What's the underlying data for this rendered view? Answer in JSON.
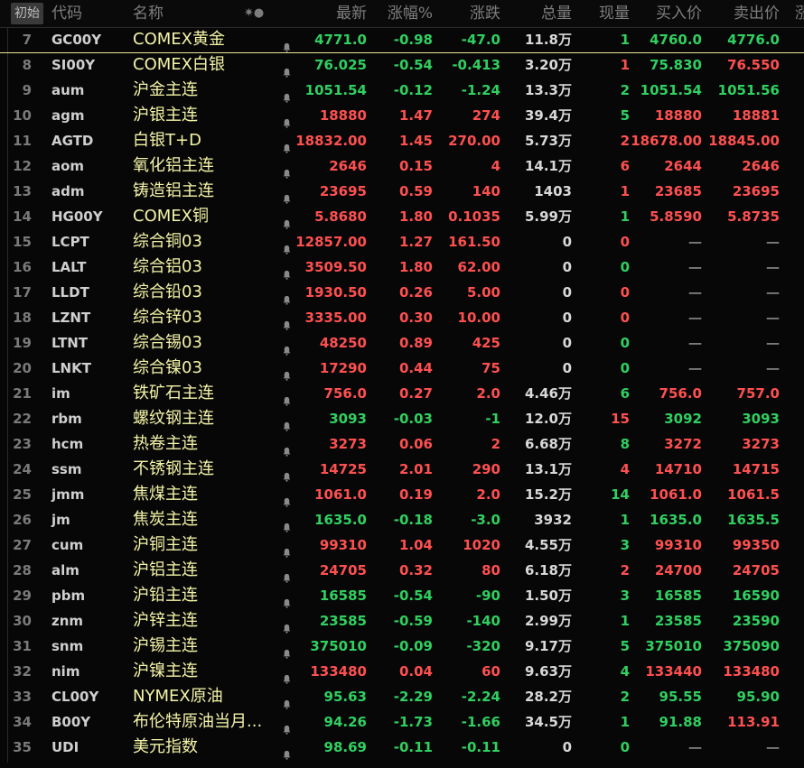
{
  "header": {
    "init_label": "初始",
    "columns": [
      "代码",
      "名称",
      "最新",
      "涨幅%",
      "涨跌",
      "总量",
      "现量",
      "买入价",
      "卖出价",
      "涨"
    ],
    "toggle_icons": "✷●"
  },
  "colors": {
    "up": "#ff5050",
    "down": "#30d060",
    "name": "#f4f4a8"
  },
  "rows": [
    {
      "num": "7",
      "code": "GC00Y",
      "name": "COMEX黄金",
      "last": "4771.0",
      "pct": "-0.98",
      "chg": "-47.0",
      "total": "11.8万",
      "cur": "1",
      "cur_dir": "dn",
      "bid": "4760.0",
      "bid_dir": "dn",
      "ask": "4776.0",
      "ask_dir": "dn"
    },
    {
      "num": "8",
      "code": "SI00Y",
      "name": "COMEX白银",
      "last": "76.025",
      "pct": "-0.54",
      "chg": "-0.413",
      "total": "3.20万",
      "cur": "1",
      "cur_dir": "up",
      "bid": "75.830",
      "bid_dir": "dn",
      "ask": "76.550",
      "ask_dir": "up"
    },
    {
      "num": "9",
      "code": "aum",
      "name": "沪金主连",
      "last": "1051.54",
      "pct": "-0.12",
      "chg": "-1.24",
      "total": "13.3万",
      "cur": "2",
      "cur_dir": "dn",
      "bid": "1051.54",
      "bid_dir": "dn",
      "ask": "1051.56",
      "ask_dir": "dn"
    },
    {
      "num": "10",
      "code": "agm",
      "name": "沪银主连",
      "last": "18880",
      "pct": "1.47",
      "chg": "274",
      "total": "39.4万",
      "cur": "5",
      "cur_dir": "dn",
      "bid": "18880",
      "bid_dir": "up",
      "ask": "18881",
      "ask_dir": "up"
    },
    {
      "num": "11",
      "code": "AGTD",
      "name": "白银T+D",
      "last": "18832.00",
      "pct": "1.45",
      "chg": "270.00",
      "total": "5.73万",
      "cur": "2",
      "cur_dir": "up",
      "bid": "18678.00",
      "bid_dir": "up",
      "ask": "18845.00",
      "ask_dir": "up"
    },
    {
      "num": "12",
      "code": "aom",
      "name": "氧化铝主连",
      "last": "2646",
      "pct": "0.15",
      "chg": "4",
      "total": "14.1万",
      "cur": "6",
      "cur_dir": "up",
      "bid": "2644",
      "bid_dir": "up",
      "ask": "2646",
      "ask_dir": "up"
    },
    {
      "num": "13",
      "code": "adm",
      "name": "铸造铝主连",
      "last": "23695",
      "pct": "0.59",
      "chg": "140",
      "total": "1403",
      "cur": "1",
      "cur_dir": "up",
      "bid": "23685",
      "bid_dir": "up",
      "ask": "23695",
      "ask_dir": "up"
    },
    {
      "num": "14",
      "code": "HG00Y",
      "name": "COMEX铜",
      "last": "5.8680",
      "pct": "1.80",
      "chg": "0.1035",
      "total": "5.99万",
      "cur": "1",
      "cur_dir": "dn",
      "bid": "5.8590",
      "bid_dir": "up",
      "ask": "5.8735",
      "ask_dir": "up"
    },
    {
      "num": "15",
      "code": "LCPT",
      "name": "综合铜03",
      "last": "12857.00",
      "pct": "1.27",
      "chg": "161.50",
      "total": "0",
      "cur": "0",
      "cur_dir": "up",
      "bid": "—",
      "bid_dir": "dash",
      "ask": "—",
      "ask_dir": "dash"
    },
    {
      "num": "16",
      "code": "LALT",
      "name": "综合铝03",
      "last": "3509.50",
      "pct": "1.80",
      "chg": "62.00",
      "total": "0",
      "cur": "0",
      "cur_dir": "dn",
      "bid": "—",
      "bid_dir": "dash",
      "ask": "—",
      "ask_dir": "dash"
    },
    {
      "num": "17",
      "code": "LLDT",
      "name": "综合铅03",
      "last": "1930.50",
      "pct": "0.26",
      "chg": "5.00",
      "total": "0",
      "cur": "0",
      "cur_dir": "up",
      "bid": "—",
      "bid_dir": "dash",
      "ask": "—",
      "ask_dir": "dash"
    },
    {
      "num": "18",
      "code": "LZNT",
      "name": "综合锌03",
      "last": "3335.00",
      "pct": "0.30",
      "chg": "10.00",
      "total": "0",
      "cur": "0",
      "cur_dir": "up",
      "bid": "—",
      "bid_dir": "dash",
      "ask": "—",
      "ask_dir": "dash"
    },
    {
      "num": "19",
      "code": "LTNT",
      "name": "综合锡03",
      "last": "48250",
      "pct": "0.89",
      "chg": "425",
      "total": "0",
      "cur": "0",
      "cur_dir": "dn",
      "bid": "—",
      "bid_dir": "dash",
      "ask": "—",
      "ask_dir": "dash"
    },
    {
      "num": "20",
      "code": "LNKT",
      "name": "综合镍03",
      "last": "17290",
      "pct": "0.44",
      "chg": "75",
      "total": "0",
      "cur": "0",
      "cur_dir": "dn",
      "bid": "—",
      "bid_dir": "dash",
      "ask": "—",
      "ask_dir": "dash"
    },
    {
      "num": "21",
      "code": "im",
      "name": "铁矿石主连",
      "last": "756.0",
      "pct": "0.27",
      "chg": "2.0",
      "total": "4.46万",
      "cur": "6",
      "cur_dir": "dn",
      "bid": "756.0",
      "bid_dir": "up",
      "ask": "757.0",
      "ask_dir": "up"
    },
    {
      "num": "22",
      "code": "rbm",
      "name": "螺纹钢主连",
      "last": "3093",
      "pct": "-0.03",
      "chg": "-1",
      "total": "12.0万",
      "cur": "15",
      "cur_dir": "up",
      "bid": "3092",
      "bid_dir": "dn",
      "ask": "3093",
      "ask_dir": "dn"
    },
    {
      "num": "23",
      "code": "hcm",
      "name": "热卷主连",
      "last": "3273",
      "pct": "0.06",
      "chg": "2",
      "total": "6.68万",
      "cur": "8",
      "cur_dir": "dn",
      "bid": "3272",
      "bid_dir": "up",
      "ask": "3273",
      "ask_dir": "up"
    },
    {
      "num": "24",
      "code": "ssm",
      "name": "不锈钢主连",
      "last": "14725",
      "pct": "2.01",
      "chg": "290",
      "total": "13.1万",
      "cur": "4",
      "cur_dir": "up",
      "bid": "14710",
      "bid_dir": "up",
      "ask": "14715",
      "ask_dir": "up"
    },
    {
      "num": "25",
      "code": "jmm",
      "name": "焦煤主连",
      "last": "1061.0",
      "pct": "0.19",
      "chg": "2.0",
      "total": "15.2万",
      "cur": "14",
      "cur_dir": "dn",
      "bid": "1061.0",
      "bid_dir": "up",
      "ask": "1061.5",
      "ask_dir": "up"
    },
    {
      "num": "26",
      "code": "jm",
      "name": "焦炭主连",
      "last": "1635.0",
      "pct": "-0.18",
      "chg": "-3.0",
      "total": "3932",
      "cur": "1",
      "cur_dir": "dn",
      "bid": "1635.0",
      "bid_dir": "dn",
      "ask": "1635.5",
      "ask_dir": "dn"
    },
    {
      "num": "27",
      "code": "cum",
      "name": "沪铜主连",
      "last": "99310",
      "pct": "1.04",
      "chg": "1020",
      "total": "4.55万",
      "cur": "3",
      "cur_dir": "dn",
      "bid": "99310",
      "bid_dir": "up",
      "ask": "99350",
      "ask_dir": "up"
    },
    {
      "num": "28",
      "code": "alm",
      "name": "沪铝主连",
      "last": "24705",
      "pct": "0.32",
      "chg": "80",
      "total": "6.18万",
      "cur": "2",
      "cur_dir": "up",
      "bid": "24700",
      "bid_dir": "up",
      "ask": "24705",
      "ask_dir": "up"
    },
    {
      "num": "29",
      "code": "pbm",
      "name": "沪铅主连",
      "last": "16585",
      "pct": "-0.54",
      "chg": "-90",
      "total": "1.50万",
      "cur": "3",
      "cur_dir": "dn",
      "bid": "16585",
      "bid_dir": "dn",
      "ask": "16590",
      "ask_dir": "dn"
    },
    {
      "num": "30",
      "code": "znm",
      "name": "沪锌主连",
      "last": "23585",
      "pct": "-0.59",
      "chg": "-140",
      "total": "2.99万",
      "cur": "1",
      "cur_dir": "dn",
      "bid": "23585",
      "bid_dir": "dn",
      "ask": "23590",
      "ask_dir": "dn"
    },
    {
      "num": "31",
      "code": "snm",
      "name": "沪锡主连",
      "last": "375010",
      "pct": "-0.09",
      "chg": "-320",
      "total": "9.17万",
      "cur": "5",
      "cur_dir": "dn",
      "bid": "375010",
      "bid_dir": "dn",
      "ask": "375090",
      "ask_dir": "dn"
    },
    {
      "num": "32",
      "code": "nim",
      "name": "沪镍主连",
      "last": "133480",
      "pct": "0.04",
      "chg": "60",
      "total": "9.63万",
      "cur": "4",
      "cur_dir": "dn",
      "bid": "133440",
      "bid_dir": "up",
      "ask": "133480",
      "ask_dir": "up"
    },
    {
      "num": "33",
      "code": "CL00Y",
      "name": "NYMEX原油",
      "last": "95.63",
      "pct": "-2.29",
      "chg": "-2.24",
      "total": "28.2万",
      "cur": "2",
      "cur_dir": "dn",
      "bid": "95.55",
      "bid_dir": "dn",
      "ask": "95.90",
      "ask_dir": "dn"
    },
    {
      "num": "34",
      "code": "B00Y",
      "name": "布伦特原油当月...",
      "last": "94.26",
      "pct": "-1.73",
      "chg": "-1.66",
      "total": "34.5万",
      "cur": "1",
      "cur_dir": "dn",
      "bid": "91.88",
      "bid_dir": "dn",
      "ask": "113.91",
      "ask_dir": "up"
    },
    {
      "num": "35",
      "code": "UDI",
      "name": "美元指数",
      "last": "98.69",
      "pct": "-0.11",
      "chg": "-0.11",
      "total": "0",
      "cur": "0",
      "cur_dir": "dn",
      "bid": "—",
      "bid_dir": "dash",
      "ask": "—",
      "ask_dir": "dash"
    }
  ]
}
